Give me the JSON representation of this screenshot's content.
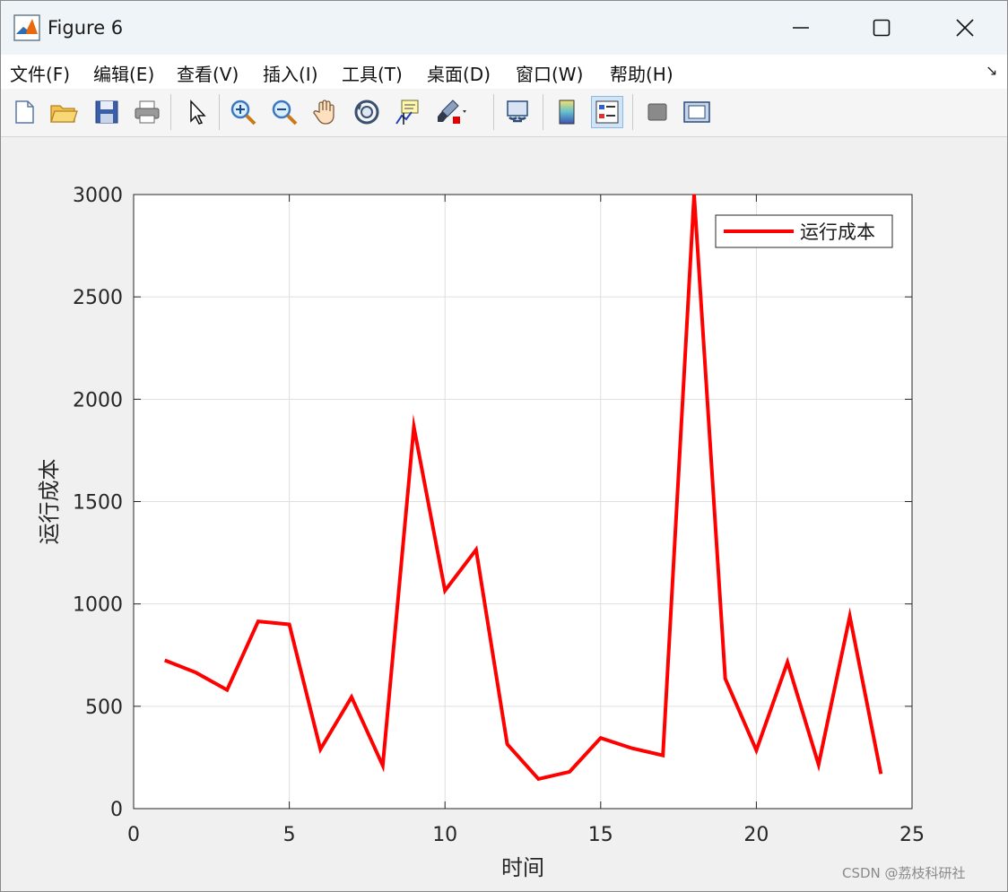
{
  "window": {
    "title": "Figure 6"
  },
  "menu": [
    "文件(F)",
    "编辑(E)",
    "查看(V)",
    "插入(I)",
    "工具(T)",
    "桌面(D)",
    "窗口(W)",
    "帮助(H)"
  ],
  "toolbar": {
    "icons": [
      "new-file-icon",
      "open-folder-icon",
      "save-icon",
      "print-icon",
      "pointer-icon",
      "zoom-in-icon",
      "zoom-out-icon",
      "pan-hand-icon",
      "rotate-3d-icon",
      "data-cursor-icon",
      "brush-icon",
      "link-plot-icon",
      "colorbar-icon",
      "legend-icon",
      "hide-plot-tools-icon",
      "show-plot-tools-icon"
    ]
  },
  "colors": {
    "line": "#ff0000",
    "accent": "#0072bd"
  },
  "chart_data": {
    "type": "line",
    "xlabel": "时间",
    "ylabel": "运行成本",
    "xlim": [
      0,
      25
    ],
    "ylim": [
      0,
      3000
    ],
    "xticks": [
      0,
      5,
      10,
      15,
      20,
      25
    ],
    "yticks": [
      0,
      500,
      1000,
      1500,
      2000,
      2500,
      3000
    ],
    "grid": true,
    "legend_position": "top-right",
    "series": [
      {
        "name": "运行成本",
        "color": "#ff0000",
        "x": [
          1,
          2,
          3,
          4,
          5,
          6,
          7,
          8,
          9,
          10,
          11,
          12,
          13,
          14,
          15,
          16,
          17,
          18,
          19,
          20,
          21,
          22,
          23,
          24
        ],
        "y": [
          725,
          665,
          580,
          915,
          900,
          290,
          545,
          210,
          1865,
          1065,
          1265,
          315,
          145,
          180,
          345,
          295,
          260,
          3000,
          635,
          285,
          715,
          215,
          940,
          170
        ]
      }
    ]
  },
  "watermark": "CSDN @荔枝科研社"
}
